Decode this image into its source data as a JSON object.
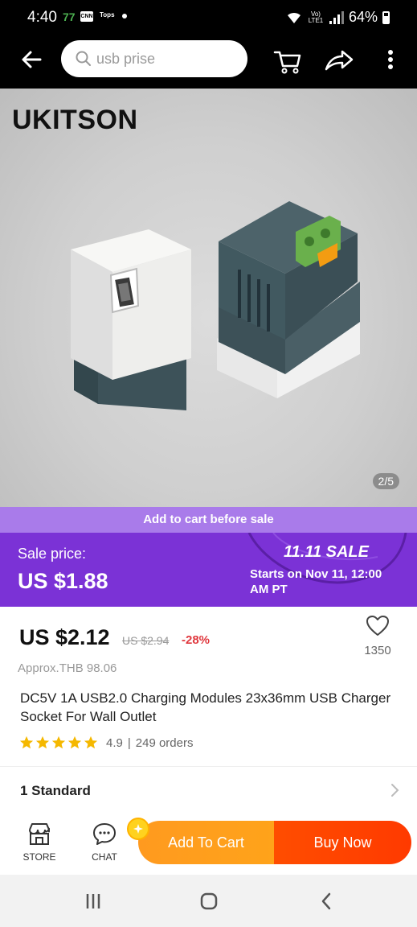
{
  "status_bar": {
    "time": "4:40",
    "temp": "77",
    "notif_cnn": "CNN",
    "notif_tops": "Tops",
    "network": "Vo) LTE1",
    "battery": "64%",
    "battery_level": 0.64
  },
  "search": {
    "placeholder": "usb prise"
  },
  "product_image": {
    "brand": "UKITSON",
    "counter": "2/5"
  },
  "presale": {
    "text": "Add to cart before sale"
  },
  "sale_banner": {
    "label": "Sale price:",
    "price": "US $1.88",
    "event": "11.11 SALE",
    "starts": "Starts on Nov 11, 12:00 AM PT",
    "accent": "#7b32d6"
  },
  "price": {
    "current": "US $2.12",
    "original": "US $2.94",
    "discount": "-28%",
    "approx": "Approx.THB 98.06",
    "wishlist_count": "1350"
  },
  "product": {
    "title": "DC5V 1A USB2.0 Charging Modules 23x36mm USB Charger Socket For Wall Outlet",
    "rating": "4.9",
    "orders": "249 orders",
    "stars": 5
  },
  "variant": {
    "label": "1 Standard"
  },
  "actions": {
    "store_label": "STORE",
    "chat_label": "CHAT",
    "add_to_cart": "Add To Cart",
    "buy_now": "Buy Now"
  },
  "icons": {
    "back": "back-arrow-icon",
    "search": "search-icon",
    "cart": "cart-icon",
    "share": "share-icon",
    "more": "more-vertical-icon",
    "heart": "heart-icon",
    "store": "store-icon",
    "chat": "chat-icon",
    "chevron": "chevron-right-icon"
  }
}
